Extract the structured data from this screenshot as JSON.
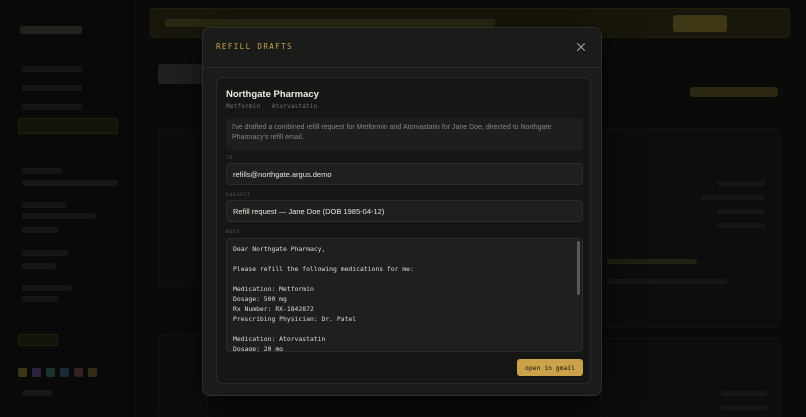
{
  "modal": {
    "title": "REFILL DRAFTS",
    "close_icon": "close-icon"
  },
  "draft": {
    "pharmacy_name": "Northgate Pharmacy",
    "medications_line": "Metformin · Atorvastatin",
    "summary": "I've drafted a combined refill request for Metformin and Atorvastatin for Jane Doe, directed to Northgate Pharmacy's refill email.",
    "to_label": "TO",
    "to_value": "refills@northgate.argus.demo",
    "subject_label": "SUBJECT",
    "subject_value": "Refill request — Jane Doe (DOB 1985-04-12)",
    "body_label": "BODY",
    "body_value": "Dear Northgate Pharmacy,\n\nPlease refill the following medications for me:\n\nMedication: Metformin\nDosage: 500 mg\nRx Number: RX-1842872\nPrescribing Physician: Dr. Patel\n\nMedication: Atorvastatin\nDosage: 20 mg",
    "open_button": "open in gmail"
  },
  "colors": {
    "accent": "#c9a24a",
    "background": "#121311",
    "modal": "#1b1c1a"
  }
}
